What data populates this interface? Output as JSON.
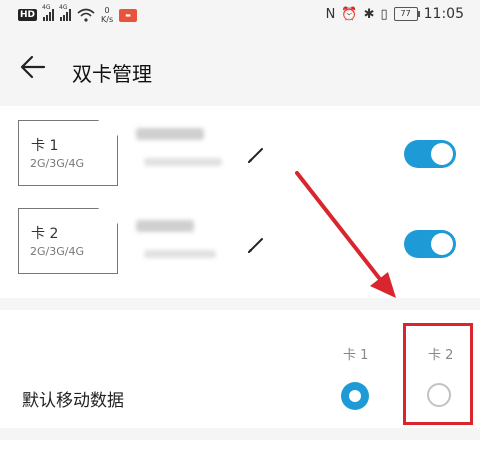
{
  "status_bar": {
    "network_badge": "HD",
    "signal_label": "4G",
    "speed_value": "0",
    "speed_unit": "K/s",
    "battery": "77",
    "time": "11:05"
  },
  "header": {
    "title": "双卡管理"
  },
  "sims": [
    {
      "name": "卡 1",
      "types": "2G/3G/4G",
      "enabled": true
    },
    {
      "name": "卡 2",
      "types": "2G/3G/4G",
      "enabled": true
    }
  ],
  "mobile_data": {
    "label": "默认移动数据",
    "col1": "卡 1",
    "col2": "卡 2",
    "selected": "卡 1"
  },
  "colors": {
    "accent": "#1e9bd7",
    "annotation": "#d9262e"
  }
}
